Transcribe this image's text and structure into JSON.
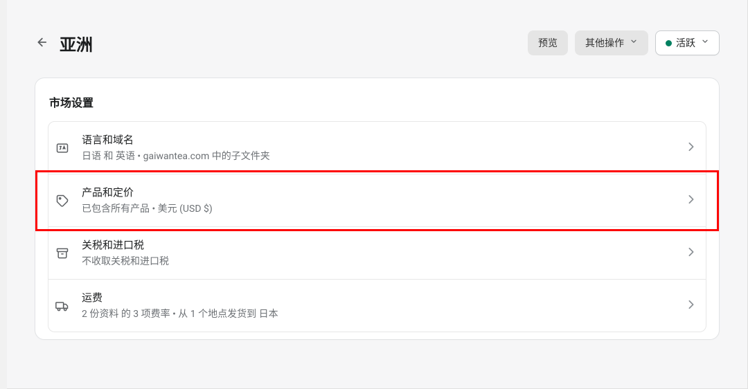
{
  "header": {
    "title": "亚洲",
    "preview_label": "预览",
    "other_actions_label": "其他操作",
    "status_label": "活跃"
  },
  "card": {
    "title": "市场设置",
    "items": [
      {
        "icon": "language-icon",
        "title": "语言和域名",
        "subtitle": "日语 和 英语 • gaiwantea.com 中的子文件夹"
      },
      {
        "icon": "tag-icon",
        "title": "产品和定价",
        "subtitle": "已包含所有产品 • 美元 (USD $)"
      },
      {
        "icon": "archive-icon",
        "title": "关税和进口税",
        "subtitle": "不收取关税和进口税"
      },
      {
        "icon": "truck-icon",
        "title": "运费",
        "subtitle": "2 份资料 的 3 项费率 • 从 1 个地点发货到 日本"
      }
    ]
  },
  "highlight": {
    "item_index": 1
  }
}
